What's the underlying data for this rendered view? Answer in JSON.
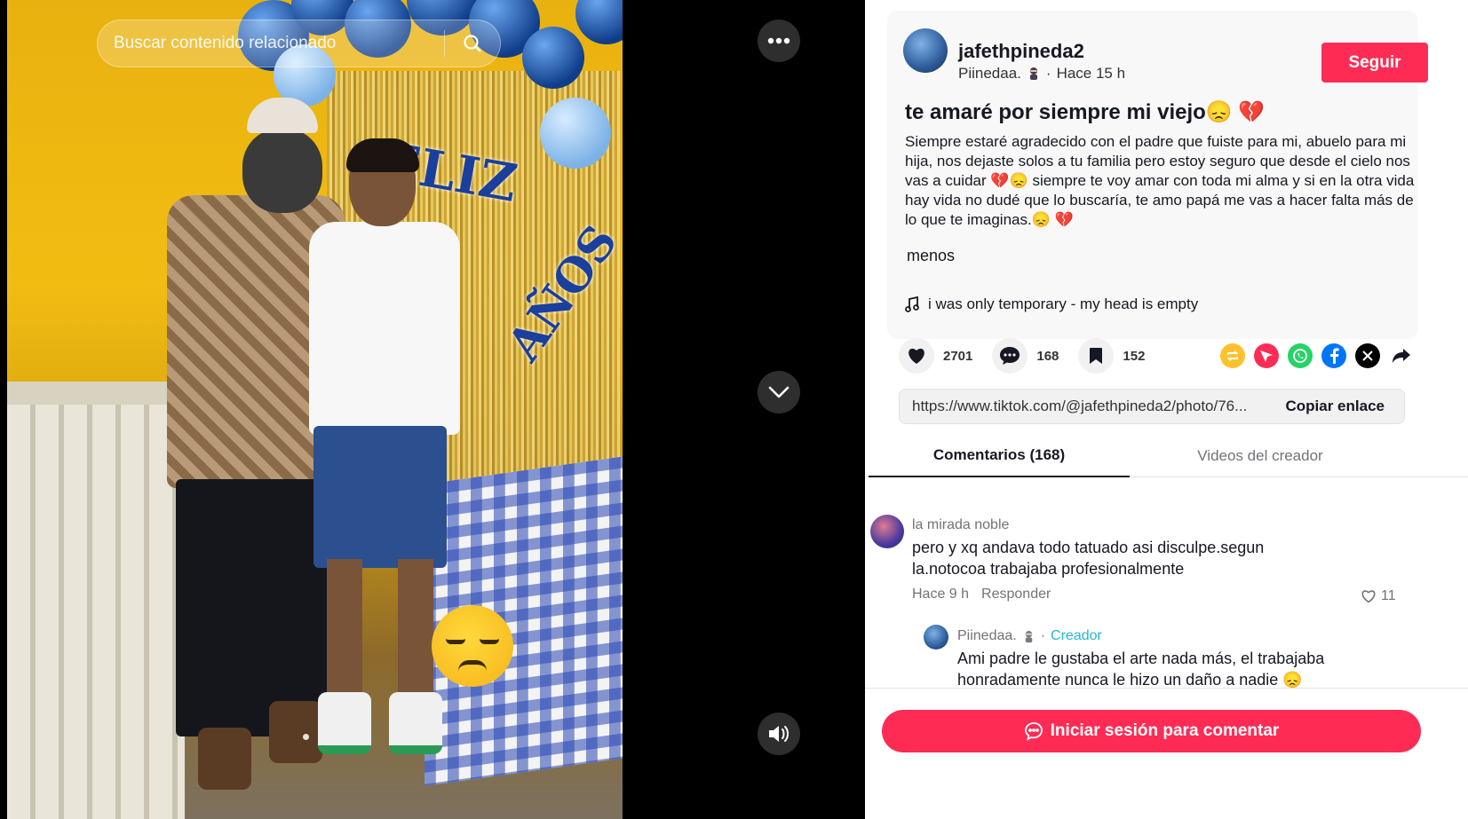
{
  "search": {
    "placeholder": "Buscar contenido relacionado"
  },
  "author": {
    "username": "jafethpineda2",
    "nickname": "Piinedaa.",
    "time_ago": "Hace 15 h",
    "follow_label": "Seguir"
  },
  "post": {
    "title": "te amaré por siempre mi viejo😞 💔",
    "body": "Siempre estaré agradecido con el padre que fuiste para mi, abuelo para mi hija, nos dejaste solos a tu familia pero estoy seguro que desde el cielo nos vas a cuidar 💔😞 siempre te voy amar con toda mi alma y si en la otra vida hay vida no dudé que lo buscaría, te amo papá me vas a hacer falta más de lo que te imaginas.😞 💔",
    "less_label": "menos",
    "music": "i was only temporary - my head is empty"
  },
  "stats": {
    "likes": "2701",
    "comments": "168",
    "saves": "152"
  },
  "share_icons": [
    "repost-icon",
    "send-icon",
    "whatsapp-icon",
    "facebook-icon",
    "x-icon",
    "share-arrow-icon"
  ],
  "link": {
    "url": "https://www.tiktok.com/@jafethpineda2/photo/76...",
    "copy_label": "Copiar enlace"
  },
  "tabs": {
    "comments": "Comentarios (168)",
    "videos": "Videos del creador"
  },
  "comments": [
    {
      "user": "la mirada noble",
      "text": "pero y xq andava todo tatuado asi disculpe.segun la.notocoa trabajaba profesionalmente",
      "time": "Hace 9 h",
      "reply_label": "Responder",
      "likes": "11"
    }
  ],
  "reply": {
    "user": "Piinedaa.",
    "separator": "·",
    "creator_label": "Creador",
    "text": "Ami padre le gustaba el arte nada más, el trabajaba honradamente nunca le hizo un daño a nadie 😞"
  },
  "login_label": "Iniciar sesión para comentar",
  "colors": {
    "brand": "#fe2c55",
    "creator": "#20b8d3"
  }
}
